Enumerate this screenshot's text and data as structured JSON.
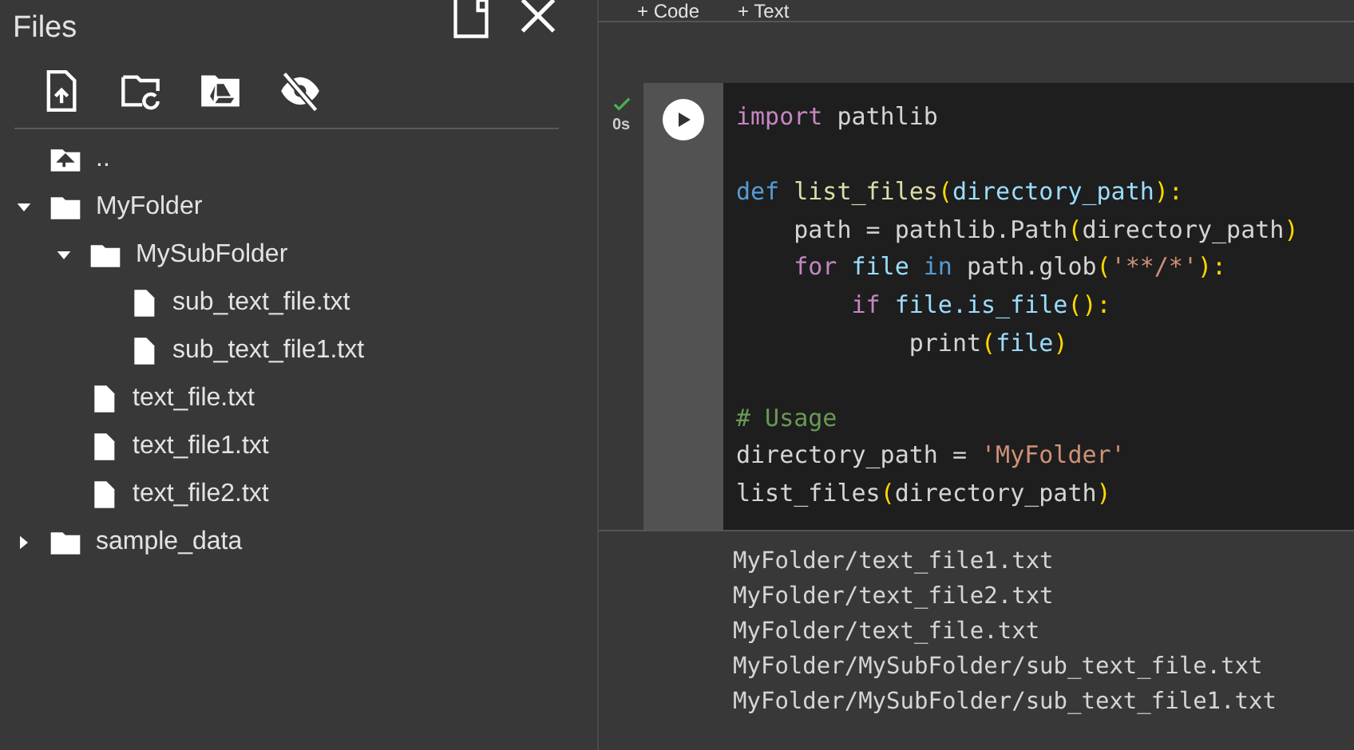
{
  "sidebar": {
    "title": "Files",
    "tree": [
      {
        "kind": "parent",
        "label": ".."
      },
      {
        "kind": "folder",
        "label": "MyFolder",
        "expanded": true,
        "children": [
          {
            "kind": "folder",
            "label": "MySubFolder",
            "expanded": true,
            "children": [
              {
                "kind": "file",
                "label": "sub_text_file.txt"
              },
              {
                "kind": "file",
                "label": "sub_text_file1.txt"
              }
            ]
          },
          {
            "kind": "file",
            "label": "text_file.txt"
          },
          {
            "kind": "file",
            "label": "text_file1.txt"
          },
          {
            "kind": "file",
            "label": "text_file2.txt"
          }
        ]
      },
      {
        "kind": "folder",
        "label": "sample_data",
        "expanded": false
      }
    ]
  },
  "toolbar": {
    "buttons": [
      "+ Code",
      "+ Text"
    ]
  },
  "cell": {
    "status": "0s",
    "code_blocks": [
      [
        [
          {
            "text": "import",
            "color": "#c586c0"
          },
          {
            "text": " pathlib",
            "color": "#d4d4d4"
          }
        ]
      ],
      [
        [
          {
            "text": "def",
            "color": "#569cd6"
          },
          {
            "text": " list_files",
            "color": "#dcdcaa"
          },
          {
            "text": "(",
            "color": "#ffd700"
          },
          {
            "text": "directory_path",
            "color": "#9cdcfe"
          },
          {
            "text": "):",
            "color": "#ffd700"
          }
        ],
        [
          {
            "text": "    path = pathlib.Path",
            "color": "#d4d4d4"
          },
          {
            "text": "(",
            "color": "#ffd700"
          },
          {
            "text": "directory_path",
            "color": "#d4d4d4"
          },
          {
            "text": ")",
            "color": "#ffd700"
          }
        ],
        [
          {
            "text": "    for",
            "color": "#c586c0"
          },
          {
            "text": " file",
            "color": "#9cdcfe"
          },
          {
            "text": " in",
            "color": "#569cd6"
          },
          {
            "text": " path.glob",
            "color": "#d4d4d4"
          },
          {
            "text": "(",
            "color": "#ffd700"
          },
          {
            "text": "'**/*'",
            "color": "#ce9178"
          },
          {
            "text": "):",
            "color": "#ffd700"
          }
        ],
        [
          {
            "text": "        if",
            "color": "#c586c0"
          },
          {
            "text": " file.is_file",
            "color": "#9cdcfe"
          },
          {
            "text": "():",
            "color": "#ffd700"
          }
        ],
        [
          {
            "text": "            print",
            "color": "#d4d4d4"
          },
          {
            "text": "(",
            "color": "#ffd700"
          },
          {
            "text": "file",
            "color": "#9cdcfe"
          },
          {
            "text": ")",
            "color": "#ffd700"
          }
        ]
      ],
      [
        [
          {
            "text": "# Usage",
            "color": "#6a9955"
          }
        ],
        [
          {
            "text": "directory_path = ",
            "color": "#d4d4d4"
          },
          {
            "text": "'MyFolder'",
            "color": "#ce9178"
          }
        ],
        [
          {
            "text": "list_files",
            "color": "#d4d4d4"
          },
          {
            "text": "(",
            "color": "#ffd700"
          },
          {
            "text": "directory_path",
            "color": "#d4d4d4"
          },
          {
            "text": ")",
            "color": "#ffd700"
          }
        ]
      ]
    ],
    "output": [
      "MyFolder/text_file1.txt",
      "MyFolder/text_file2.txt",
      "MyFolder/text_file.txt",
      "MyFolder/MySubFolder/sub_text_file.txt",
      "MyFolder/MySubFolder/sub_text_file1.txt"
    ]
  }
}
